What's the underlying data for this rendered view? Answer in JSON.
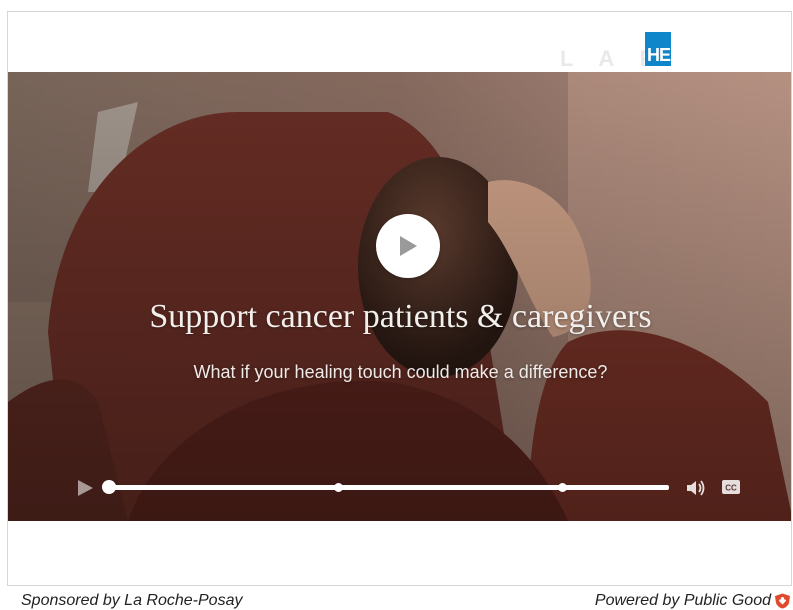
{
  "brand": {
    "logo_text": "L A      F",
    "logo_block_text": "HE",
    "logo_color": "#0f86c9"
  },
  "video": {
    "headline": "Support cancer patients & caregivers",
    "subheadline": "What if your healing touch could make a difference?",
    "controls": {
      "play_icon": "play-icon",
      "volume_icon": "volume-icon",
      "captions_icon": "closed-captions-icon",
      "progress": 0.0,
      "chapter_markers": [
        0.41,
        0.81
      ]
    }
  },
  "footer": {
    "sponsored_label": "Sponsored by La Roche-Posay",
    "powered_label": "Powered by Public Good",
    "powered_icon": "public-good-shield-icon",
    "powered_icon_color": "#e04a2f"
  }
}
